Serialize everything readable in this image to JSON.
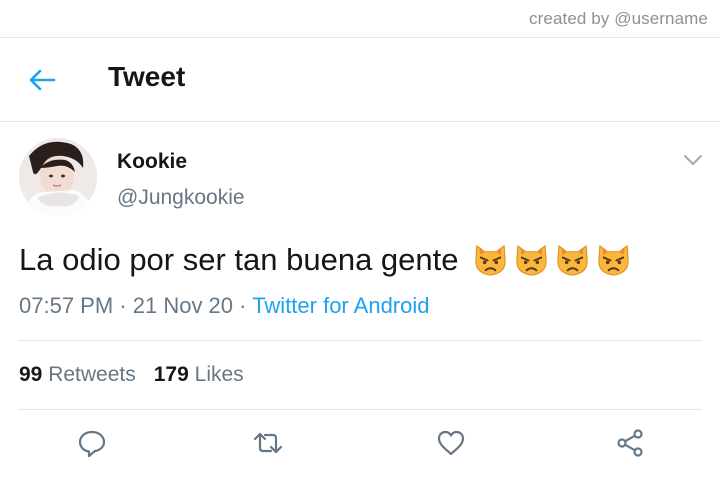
{
  "watermark": "created by @username",
  "header": {
    "title": "Tweet",
    "back_icon": "arrow-left-icon"
  },
  "tweet": {
    "author_name": "Kookie",
    "author_handle": "@Jungkookie",
    "text": "La odio por ser tan buena gente",
    "emojis": [
      "pouting-cat-face",
      "pouting-cat-face",
      "pouting-cat-face",
      "pouting-cat-face"
    ],
    "time": "07:57 PM",
    "date": "21 Nov 20",
    "source": "Twitter for Android",
    "separator": " · ",
    "retweets_count": "99",
    "retweets_label": "Retweets",
    "likes_count": "179",
    "likes_label": "Likes"
  },
  "actions": [
    "reply-icon",
    "retweet-icon",
    "like-icon",
    "share-icon"
  ],
  "colors": {
    "accent": "#1da1f2",
    "secondary_text": "#657786",
    "primary_text": "#14171a",
    "divider": "#e1e8ed",
    "emoji": "#f9b73c"
  }
}
